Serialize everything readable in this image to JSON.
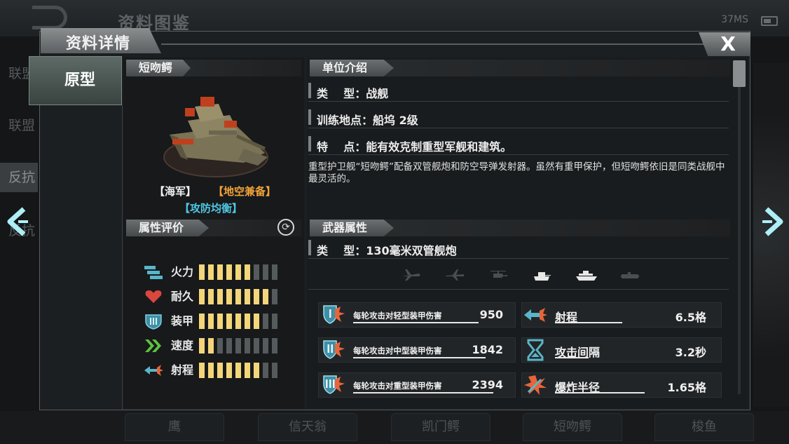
{
  "background": {
    "title": "资料图鉴",
    "status": "37MS",
    "left_items": [
      "联盟",
      "联盟",
      "反抗",
      "反抗"
    ],
    "bottom_tabs": [
      "鹰",
      "信天翁",
      "凯门鳄",
      "短吻鳄",
      "梭鱼"
    ]
  },
  "dialog": {
    "title": "资料详情",
    "close_label": "X",
    "side_tab": "原型"
  },
  "unit": {
    "name": "短吻鳄",
    "tags": [
      "【海军】",
      "【地空兼备】",
      "【攻防均衡】"
    ],
    "attr_header": "属性评价",
    "stats": [
      {
        "label": "火力",
        "icon": "firepower-icon",
        "level": 6,
        "max": 9
      },
      {
        "label": "耐久",
        "icon": "heart-icon",
        "level": 8,
        "max": 9
      },
      {
        "label": "装甲",
        "icon": "armor-shield-icon",
        "level": 7,
        "max": 9
      },
      {
        "label": "速度",
        "icon": "speed-chevron-icon",
        "level": 2,
        "max": 9
      },
      {
        "label": "射程",
        "icon": "range-icon",
        "level": 7,
        "max": 9
      }
    ]
  },
  "intro": {
    "header": "单位介绍",
    "type_row": "类    型：战舰",
    "train_row": "训练地点：船坞 2级",
    "feature_row": "特    点：能有效克制重型军舰和建筑。",
    "description": "重型护卫舰“短吻鳄”配备双管舰炮和防空导弹发射器。虽然有重甲保护，但短吻鳄依旧是同类战舰中最灵活的。"
  },
  "weapon": {
    "header": "武器属性",
    "type_row": "类    型：130毫米双管舰炮",
    "targets": [
      {
        "icon": "fighter-jet-icon",
        "active": false
      },
      {
        "icon": "bomber-plane-icon",
        "active": false
      },
      {
        "icon": "helicopter-icon",
        "active": false
      },
      {
        "icon": "tank-icon",
        "active": true
      },
      {
        "icon": "ship-icon",
        "active": true
      },
      {
        "icon": "submarine-icon",
        "active": false
      }
    ],
    "damage": [
      {
        "label": "每轮攻击对轻型装甲伤害",
        "value": "950",
        "icon": "light-armor-damage-icon",
        "fill": 0.85
      },
      {
        "label": "每轮攻击对中型装甲伤害",
        "value": "1842",
        "icon": "medium-armor-damage-icon",
        "fill": 0.9
      },
      {
        "label": "每轮攻击对重型装甲伤害",
        "value": "2394",
        "icon": "heavy-armor-damage-icon",
        "fill": 0.95
      }
    ],
    "props": [
      {
        "label": "射程",
        "value": "6.5格",
        "icon": "range-arrow-icon",
        "fill": 0.6
      },
      {
        "label": "攻击间隔",
        "value": "3.2秒",
        "icon": "hourglass-icon",
        "fill": 0.3
      },
      {
        "label": "爆炸半径",
        "value": "1.65格",
        "icon": "explosion-icon",
        "fill": 0.8
      }
    ]
  },
  "colors": {
    "bar_on": "#f3d67a",
    "bar_off": "#555a5c",
    "tag_navy": "#f0a338",
    "tag_balance": "#4fc7e3",
    "accent_cyan": "#9fe6f0"
  }
}
